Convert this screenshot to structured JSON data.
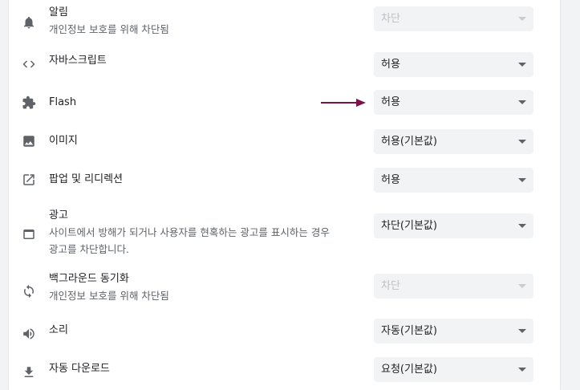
{
  "settings": [
    {
      "name": "notifications",
      "icon": "bell-icon",
      "title": "알림",
      "desc": "개인정보 보호를 위해 차단됨",
      "value": "차단",
      "disabled": true
    },
    {
      "name": "javascript",
      "icon": "code-icon",
      "title": "자바스크립트",
      "desc": "",
      "value": "허용",
      "disabled": false
    },
    {
      "name": "flash",
      "icon": "puzzle-icon",
      "title": "Flash",
      "desc": "",
      "value": "허용",
      "disabled": false
    },
    {
      "name": "images",
      "icon": "image-icon",
      "title": "이미지",
      "desc": "",
      "value": "허용(기본값)",
      "disabled": false
    },
    {
      "name": "popups",
      "icon": "open-in-new-icon",
      "title": "팝업 및 리디렉션",
      "desc": "",
      "value": "허용",
      "disabled": false
    },
    {
      "name": "ads",
      "icon": "window-icon",
      "title": "광고",
      "desc": "사이트에서 방해가 되거나 사용자를 현혹하는 광고를 표시하는 경우",
      "desc2": "광고를 차단합니다.",
      "value": "차단(기본값)",
      "disabled": false
    },
    {
      "name": "background-sync",
      "icon": "sync-icon",
      "title": "백그라운드 동기화",
      "desc": "개인정보 보호를 위해 차단됨",
      "value": "차단",
      "disabled": true
    },
    {
      "name": "sound",
      "icon": "volume-icon",
      "title": "소리",
      "desc": "",
      "value": "자동(기본값)",
      "disabled": false
    },
    {
      "name": "downloads",
      "icon": "download-icon",
      "title": "자동 다운로드",
      "desc": "",
      "value": "요청(기본값)",
      "disabled": false
    }
  ],
  "colors": {
    "arrow": "#7b1346"
  }
}
